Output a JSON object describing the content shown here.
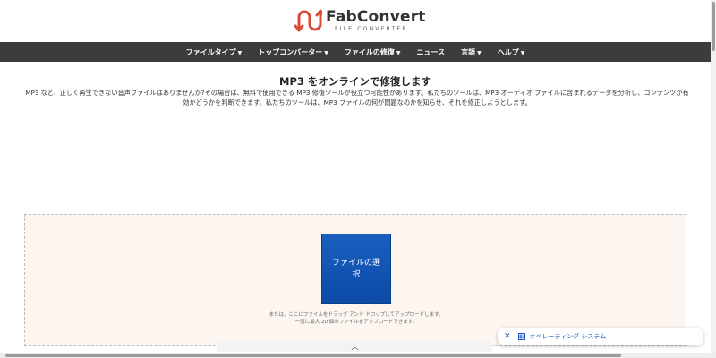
{
  "header": {
    "brand_name": "FabConvert",
    "brand_sub": "FILE CONVERTER",
    "brand_color": "#d94a38"
  },
  "nav": {
    "items": [
      {
        "label": "ファイルタイプ",
        "caret": "▼"
      },
      {
        "label": "トップコンバーター",
        "caret": "▼"
      },
      {
        "label": "ファイルの修復",
        "caret": "▼"
      },
      {
        "label": "ニュース",
        "caret": ""
      },
      {
        "label": "言語",
        "caret": "▼"
      },
      {
        "label": "ヘルプ",
        "caret": "▼"
      }
    ]
  },
  "main": {
    "title": "MP3 をオンラインで修復します",
    "intro": "MP3 など、正しく再生できない音声ファイルはありませんか?その場合は、無料で使用できる MP3 修復ツールが役立つ可能性があります。私たちのツールは、MP3 オーディオ ファイルに含まれるデータを分析し、コンテンツが有効かどうかを判断できます。私たちのツールは、MP3 ファイルの何が問題なのかを知らせ、それを修正しようとします。"
  },
  "upload": {
    "button_label": "ファイルの選択",
    "hint_line1": "または、ここにファイルをドラッグ アンド ドロップしてアップロードします。",
    "hint_line2": "一度に最大 20 個のファイルをアップロードできます。",
    "button_color": "#1256b8"
  },
  "collapse": {
    "chevron": "︿"
  },
  "toast": {
    "close_symbol": "✕",
    "icon": "grid-icon",
    "label": "オペレーティング システム"
  }
}
